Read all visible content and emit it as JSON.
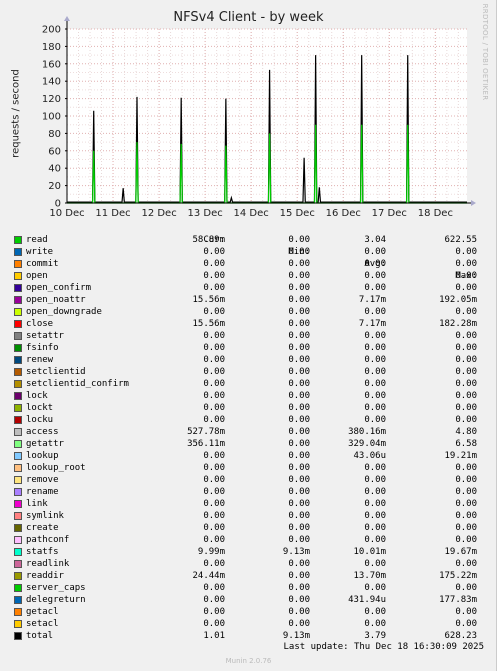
{
  "title": "NFSv4 Client - by week",
  "ylabel": "requests / second",
  "side_text": "RRDTOOL / TOBI OETIKER",
  "footer": "Last update: Thu Dec 18 16:30:09 2025",
  "munin": "Munin 2.0.76",
  "headers": {
    "cur": "Cur:",
    "min": "Min:",
    "avg": "Avg:",
    "max": "Max:"
  },
  "chart_data": {
    "type": "area",
    "title": "NFSv4 Client - by week",
    "ylabel": "requests / second",
    "ylim": [
      0,
      200
    ],
    "yticks": [
      0,
      20,
      40,
      60,
      80,
      100,
      120,
      140,
      160,
      180,
      200
    ],
    "xlim": [
      "2025-12-10T00:00",
      "2025-12-18T16:30"
    ],
    "xticks": [
      "10 Dec",
      "11 Dec",
      "12 Dec",
      "13 Dec",
      "14 Dec",
      "15 Dec",
      "16 Dec",
      "17 Dec",
      "18 Dec"
    ],
    "grid": true,
    "series": [
      {
        "name": "total",
        "color": "#000000",
        "peaks": [
          {
            "day": 10.58,
            "value": 106
          },
          {
            "day": 11.22,
            "value": 17
          },
          {
            "day": 11.52,
            "value": 122
          },
          {
            "day": 12.48,
            "value": 121
          },
          {
            "day": 13.45,
            "value": 120
          },
          {
            "day": 13.57,
            "value": 6
          },
          {
            "day": 14.4,
            "value": 153
          },
          {
            "day": 15.15,
            "value": 52
          },
          {
            "day": 15.4,
            "value": 170
          },
          {
            "day": 15.48,
            "value": 18
          },
          {
            "day": 16.4,
            "value": 170
          },
          {
            "day": 17.4,
            "value": 170
          }
        ],
        "baseline": 1.0
      },
      {
        "name": "getattr",
        "color": "#00cc00",
        "peaks": [
          {
            "day": 10.58,
            "value": 60
          },
          {
            "day": 11.52,
            "value": 70
          },
          {
            "day": 12.48,
            "value": 68
          },
          {
            "day": 13.45,
            "value": 66
          },
          {
            "day": 14.4,
            "value": 80
          },
          {
            "day": 15.4,
            "value": 90
          },
          {
            "day": 16.4,
            "value": 90
          },
          {
            "day": 17.4,
            "value": 90
          }
        ]
      }
    ]
  },
  "legend": [
    {
      "name": "read",
      "color": "#00cc00",
      "cur": "58.89m",
      "min": "0.00",
      "avg": "3.04",
      "max": "622.55"
    },
    {
      "name": "write",
      "color": "#0066b3",
      "cur": "0.00",
      "min": "0.00",
      "avg": "0.00",
      "max": "0.00"
    },
    {
      "name": "commit",
      "color": "#ff8000",
      "cur": "0.00",
      "min": "0.00",
      "avg": "0.00",
      "max": "0.00"
    },
    {
      "name": "open",
      "color": "#ffcc00",
      "cur": "0.00",
      "min": "0.00",
      "avg": "0.00",
      "max": "0.00"
    },
    {
      "name": "open_confirm",
      "color": "#330099",
      "cur": "0.00",
      "min": "0.00",
      "avg": "0.00",
      "max": "0.00"
    },
    {
      "name": "open_noattr",
      "color": "#990099",
      "cur": "15.56m",
      "min": "0.00",
      "avg": "7.17m",
      "max": "192.05m"
    },
    {
      "name": "open_downgrade",
      "color": "#ccff00",
      "cur": "0.00",
      "min": "0.00",
      "avg": "0.00",
      "max": "0.00"
    },
    {
      "name": "close",
      "color": "#ff0000",
      "cur": "15.56m",
      "min": "0.00",
      "avg": "7.17m",
      "max": "182.28m"
    },
    {
      "name": "setattr",
      "color": "#808080",
      "cur": "0.00",
      "min": "0.00",
      "avg": "0.00",
      "max": "0.00"
    },
    {
      "name": "fsinfo",
      "color": "#008f00",
      "cur": "0.00",
      "min": "0.00",
      "avg": "0.00",
      "max": "0.00"
    },
    {
      "name": "renew",
      "color": "#00487d",
      "cur": "0.00",
      "min": "0.00",
      "avg": "0.00",
      "max": "0.00"
    },
    {
      "name": "setclientid",
      "color": "#b35a00",
      "cur": "0.00",
      "min": "0.00",
      "avg": "0.00",
      "max": "0.00"
    },
    {
      "name": "setclientid_confirm",
      "color": "#b38f00",
      "cur": "0.00",
      "min": "0.00",
      "avg": "0.00",
      "max": "0.00"
    },
    {
      "name": "lock",
      "color": "#6b006b",
      "cur": "0.00",
      "min": "0.00",
      "avg": "0.00",
      "max": "0.00"
    },
    {
      "name": "lockt",
      "color": "#8fb300",
      "cur": "0.00",
      "min": "0.00",
      "avg": "0.00",
      "max": "0.00"
    },
    {
      "name": "locku",
      "color": "#b30000",
      "cur": "0.00",
      "min": "0.00",
      "avg": "0.00",
      "max": "0.00"
    },
    {
      "name": "access",
      "color": "#bebebe",
      "cur": "527.78m",
      "min": "0.00",
      "avg": "380.16m",
      "max": "4.80"
    },
    {
      "name": "getattr",
      "color": "#80ff80",
      "cur": "356.11m",
      "min": "0.00",
      "avg": "329.04m",
      "max": "6.58"
    },
    {
      "name": "lookup",
      "color": "#80c9ff",
      "cur": "0.00",
      "min": "0.00",
      "avg": "43.06u",
      "max": "19.21m"
    },
    {
      "name": "lookup_root",
      "color": "#ffc080",
      "cur": "0.00",
      "min": "0.00",
      "avg": "0.00",
      "max": "0.00"
    },
    {
      "name": "remove",
      "color": "#ffe680",
      "cur": "0.00",
      "min": "0.00",
      "avg": "0.00",
      "max": "0.00"
    },
    {
      "name": "rename",
      "color": "#aa80ff",
      "cur": "0.00",
      "min": "0.00",
      "avg": "0.00",
      "max": "0.00"
    },
    {
      "name": "link",
      "color": "#ee00cc",
      "cur": "0.00",
      "min": "0.00",
      "avg": "0.00",
      "max": "0.00"
    },
    {
      "name": "symlink",
      "color": "#ff8080",
      "cur": "0.00",
      "min": "0.00",
      "avg": "0.00",
      "max": "0.00"
    },
    {
      "name": "create",
      "color": "#666600",
      "cur": "0.00",
      "min": "0.00",
      "avg": "0.00",
      "max": "0.00"
    },
    {
      "name": "pathconf",
      "color": "#ffbfff",
      "cur": "0.00",
      "min": "0.00",
      "avg": "0.00",
      "max": "0.00"
    },
    {
      "name": "statfs",
      "color": "#00ffcc",
      "cur": "9.99m",
      "min": "9.13m",
      "avg": "10.01m",
      "max": "19.67m"
    },
    {
      "name": "readlink",
      "color": "#cc6699",
      "cur": "0.00",
      "min": "0.00",
      "avg": "0.00",
      "max": "0.00"
    },
    {
      "name": "readdir",
      "color": "#999900",
      "cur": "24.44m",
      "min": "0.00",
      "avg": "13.70m",
      "max": "175.22m"
    },
    {
      "name": "server_caps",
      "color": "#00cc00",
      "cur": "0.00",
      "min": "0.00",
      "avg": "0.00",
      "max": "0.00"
    },
    {
      "name": "delegreturn",
      "color": "#0066b3",
      "cur": "0.00",
      "min": "0.00",
      "avg": "431.94u",
      "max": "177.83m"
    },
    {
      "name": "getacl",
      "color": "#ff8000",
      "cur": "0.00",
      "min": "0.00",
      "avg": "0.00",
      "max": "0.00"
    },
    {
      "name": "setacl",
      "color": "#ffcc00",
      "cur": "0.00",
      "min": "0.00",
      "avg": "0.00",
      "max": "0.00"
    },
    {
      "name": "total",
      "color": "#000000",
      "cur": "1.01",
      "min": "9.13m",
      "avg": "3.79",
      "max": "628.23"
    }
  ]
}
